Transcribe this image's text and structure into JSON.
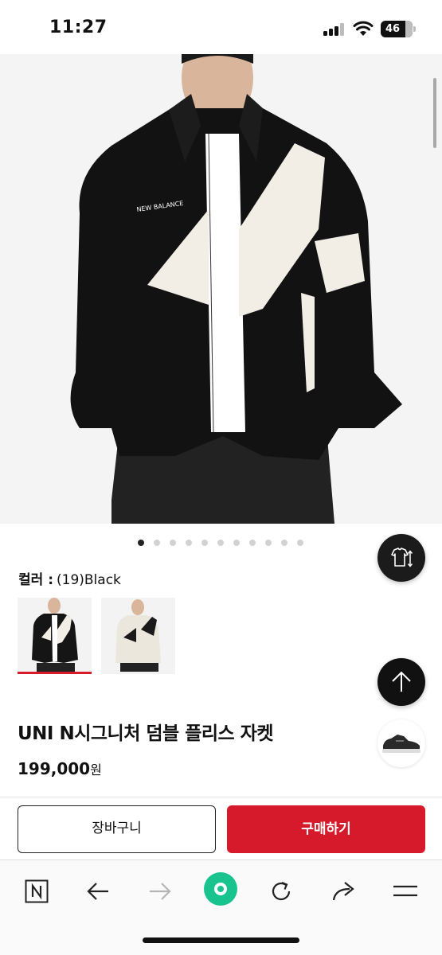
{
  "status_bar": {
    "time": "11:27",
    "battery": "46"
  },
  "carousel": {
    "total_slides": 11,
    "active_index": 0
  },
  "product": {
    "color_label": "컬러 :",
    "color_value": "(19)Black",
    "name": "UNI N시그니처 덤블 플리스 자켓",
    "price": "199,000",
    "price_unit": "원"
  },
  "actions": {
    "cart_label": "장바구니",
    "buy_label": "구매하기"
  },
  "colors": {
    "accent": "#d61a2b",
    "browser_home": "#19c38e"
  },
  "icons": {
    "size_guide": "tshirt-size-icon",
    "scroll_top": "arrow-up-icon",
    "recent_item": "sneaker-thumbnail",
    "toolbar": [
      "naver-n-icon",
      "back-arrow-icon",
      "forward-arrow-icon",
      "green-home-icon",
      "refresh-icon",
      "share-icon",
      "menu-icon"
    ]
  }
}
